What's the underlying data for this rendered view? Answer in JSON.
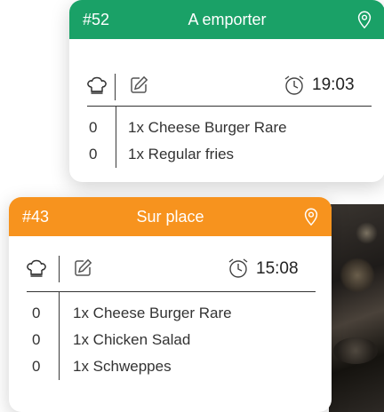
{
  "orders": [
    {
      "number": "#52",
      "type": "A emporter",
      "time": "19:03",
      "items": [
        {
          "qty": "0",
          "label": "1x Cheese Burger Rare"
        },
        {
          "qty": "0",
          "label": "1x Regular fries"
        }
      ],
      "color": "#1aa167"
    },
    {
      "number": "#43",
      "type": "Sur place",
      "time": "15:08",
      "items": [
        {
          "qty": "0",
          "label": "1x Cheese Burger Rare"
        },
        {
          "qty": "0",
          "label": "1x Chicken Salad"
        },
        {
          "qty": "0",
          "label": "1x Schweppes"
        }
      ],
      "color": "#f7931e"
    }
  ],
  "icons": [
    "chef-hat-icon",
    "edit-icon",
    "alarm-clock-icon",
    "location-pin-icon"
  ]
}
